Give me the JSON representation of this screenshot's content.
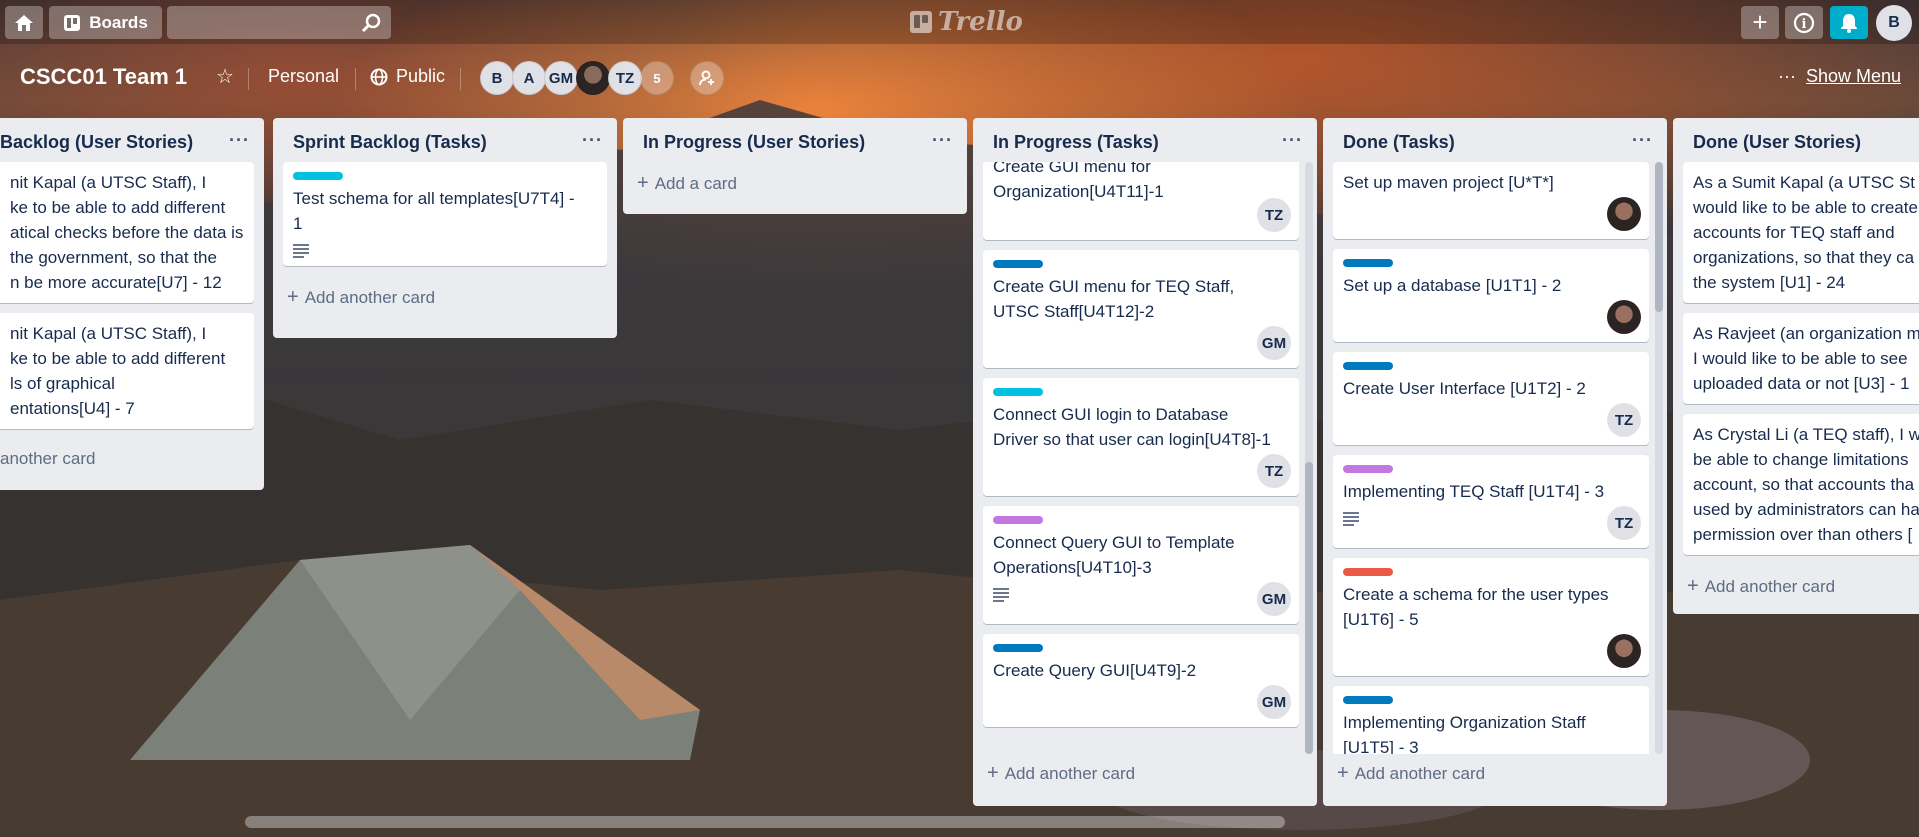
{
  "topbar": {
    "boards_label": "Boards",
    "logo_text": "Trello",
    "avatar_initial": "B",
    "plus_glyph": "+",
    "info_glyph": "i"
  },
  "board": {
    "title": "CSCC01 Team 1",
    "team_label": "Personal",
    "visibility_label": "Public",
    "members": [
      "B",
      "A",
      "GM",
      "",
      "TZ"
    ],
    "extra_members_count": "5",
    "show_menu_label": "Show Menu"
  },
  "lists": [
    {
      "title": "Backlog (User Stories)",
      "cards": [
        {
          "text": "nit Kapal (a UTSC Staff), I\nke to be able to add different\natical checks before the data is\nthe government, so that the\nn be more accurate[U7] - 12"
        },
        {
          "text": "nit Kapal (a UTSC Staff), I\nke to be able to add different\nls of graphical\nentations[U4] - 7"
        }
      ],
      "add_label": "another card"
    },
    {
      "title": "Sprint Backlog (Tasks)",
      "cards": [
        {
          "label_color": "#00c2e0",
          "text": "Test schema for all templates[U7T4] -\n1",
          "has_desc": true
        }
      ],
      "add_label": "Add another card"
    },
    {
      "title": "In Progress (User Stories)",
      "cards": [],
      "add_label": "Add a card"
    },
    {
      "title": "In Progress (Tasks)",
      "cards": [
        {
          "text": "Create GUI menu for\nOrganization[U4T11]-1",
          "member": "TZ"
        },
        {
          "label_color": "#0079bf",
          "text": "Create GUI menu for TEQ Staff,\nUTSC Staff[U4T12]-2",
          "member": "GM"
        },
        {
          "label_color": "#00c2e0",
          "text": "Connect GUI login to Database\nDriver so that user can login[U4T8]-1",
          "member": "TZ"
        },
        {
          "label_color": "#c377e0",
          "text": "Connect Query GUI to Template\nOperations[U4T10]-3",
          "member": "GM",
          "has_desc": true
        },
        {
          "label_color": "#0079bf",
          "text": "Create Query GUI[U4T9]-2",
          "member": "GM"
        }
      ],
      "add_label": "Add another card"
    },
    {
      "title": "Done (Tasks)",
      "cards": [
        {
          "text": "Set up maven project [U*T*]",
          "member": ""
        },
        {
          "label_color": "#0079bf",
          "text": "Set up a database [U1T1] - 2",
          "member": ""
        },
        {
          "label_color": "#0079bf",
          "text": "Create User Interface [U1T2] - 2",
          "member": "TZ"
        },
        {
          "label_color": "#c377e0",
          "text": "Implementing TEQ Staff [U1T4] - 3",
          "member": "TZ",
          "has_desc": true
        },
        {
          "label_color": "#eb5a46",
          "text": "Create a schema for the user types\n[U1T6] - 5",
          "member": ""
        },
        {
          "label_color": "#0079bf",
          "text": "Implementing Organization Staff\n[U1T5] - 3"
        }
      ],
      "add_label": "Add another card"
    },
    {
      "title": "Done (User Stories)",
      "cards": [
        {
          "text": "As a Sumit Kapal (a UTSC St\nwould like to be able to create\naccounts for TEQ staff and\norganizations, so that they ca\nthe system [U1] - 24"
        },
        {
          "text": "As Ravjeet (an organization m\nI would like to be able to see\nuploaded data or not [U3] - 1"
        },
        {
          "text": "As Crystal Li (a TEQ staff), I w\nbe able to change limitations\naccount, so that accounts tha\nused by administrators can ha\npermission over than others ["
        }
      ],
      "add_label": "Add another card"
    }
  ],
  "colors": {
    "cyan": "#00c2e0",
    "blue": "#0079bf",
    "purple": "#c377e0",
    "red": "#eb5a46",
    "bell": "#00aecc"
  }
}
